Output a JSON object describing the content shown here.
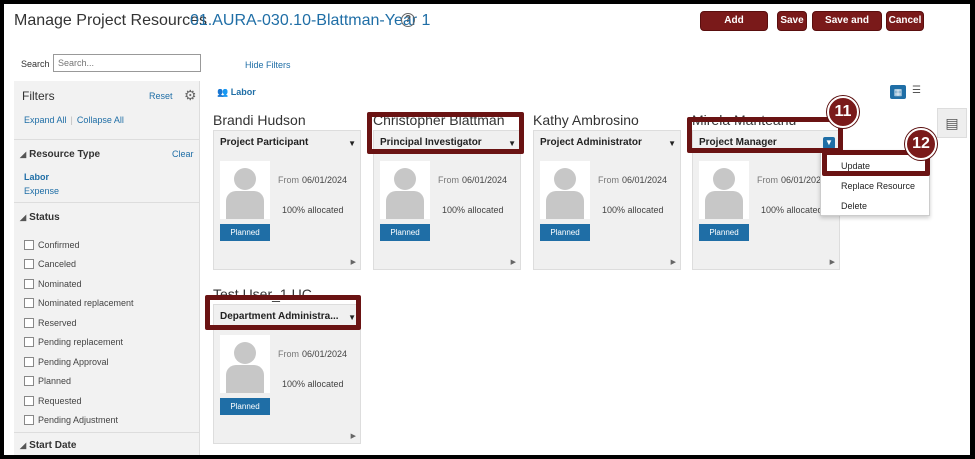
{
  "header": {
    "title": "Manage Project Resources",
    "project": "01.AURA-030.10-Blattman-Year 1",
    "help": "?",
    "buttons": {
      "add_resource": "Add Resource",
      "save": "Save",
      "save_close": "Save and Close",
      "cancel": "Cancel"
    }
  },
  "search": {
    "label": "Search",
    "placeholder": "Search...",
    "hide_filters": "Hide Filters"
  },
  "filters": {
    "title": "Filters",
    "reset": "Reset",
    "expand_all": "Expand All",
    "collapse_all": "Collapse All",
    "resource_type": {
      "title": "Resource Type",
      "clear": "Clear",
      "items": [
        "Labor",
        "Expense"
      ]
    },
    "status": {
      "title": "Status",
      "items": [
        "Confirmed",
        "Canceled",
        "Nominated",
        "Nominated replacement",
        "Reserved",
        "Pending replacement",
        "Pending Approval",
        "Planned",
        "Requested",
        "Pending Adjustment"
      ]
    },
    "start_date": {
      "title": "Start Date"
    }
  },
  "main": {
    "labor_tag": "Labor",
    "cards": [
      {
        "name": "Brandi Hudson",
        "role": "Project Participant",
        "from_label": "From",
        "date": "06/01/2024",
        "alloc": "100% allocated",
        "status": "Planned"
      },
      {
        "name": "Christopher Blattman",
        "role": "Principal Investigator",
        "from_label": "From",
        "date": "06/01/2024",
        "alloc": "100% allocated",
        "status": "Planned"
      },
      {
        "name": "Kathy Ambrosino",
        "role": "Project Administrator",
        "from_label": "From",
        "date": "06/01/2024",
        "alloc": "100% allocated",
        "status": "Planned"
      },
      {
        "name": "Mirela Manteanu",
        "role": "Project Manager",
        "from_label": "From",
        "date": "06/01/2024",
        "alloc": "100% allocated",
        "status": "Planned"
      },
      {
        "name": "Test User_1 UC",
        "role": "Department Administra...",
        "from_label": "From",
        "date": "06/01/2024",
        "alloc": "100% allocated",
        "status": "Planned"
      }
    ]
  },
  "menu": {
    "items": [
      "Update",
      "Replace Resource",
      "Delete"
    ]
  },
  "callouts": {
    "step11": "11",
    "step12": "12"
  },
  "colors": {
    "brand_button": "#7a1a1a",
    "link": "#1f6ea6",
    "callout": "#6a1313"
  }
}
